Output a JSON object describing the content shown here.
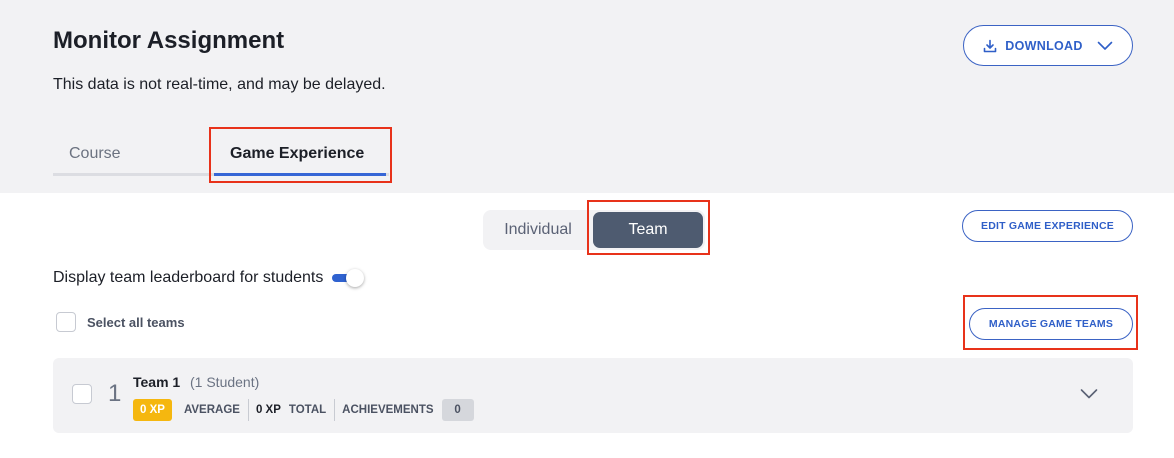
{
  "header": {
    "title": "Monitor Assignment",
    "subtitle": "This data is not real-time, and may be delayed.",
    "download_label": "DOWNLOAD"
  },
  "tabs": [
    {
      "label": "Course",
      "active": false
    },
    {
      "label": "Game Experience",
      "active": true
    }
  ],
  "view_toggle": {
    "options": [
      "Individual",
      "Team"
    ],
    "selected": "Team"
  },
  "edit_button_label": "EDIT GAME EXPERIENCE",
  "leaderboard_toggle": {
    "label": "Display team leaderboard for students",
    "enabled": true
  },
  "select_all_label": "Select all teams",
  "manage_button_label": "MANAGE GAME TEAMS",
  "teams": [
    {
      "rank": "1",
      "name": "Team 1",
      "student_count": "(1 Student)",
      "average_xp": "0 XP",
      "average_label": "AVERAGE",
      "total_xp": "0 XP",
      "total_label": "TOTAL",
      "achievements_label": "ACHIEVEMENTS",
      "achievements": "0"
    }
  ],
  "colors": {
    "accent": "#2f5fc8",
    "highlight": "#e8321a",
    "xp_badge": "#f5b70f",
    "team_active": "#4e5b70"
  },
  "icons": {
    "download": "download-icon",
    "download_chevron": "chevron-down-icon",
    "expand": "chevron-down-icon"
  }
}
